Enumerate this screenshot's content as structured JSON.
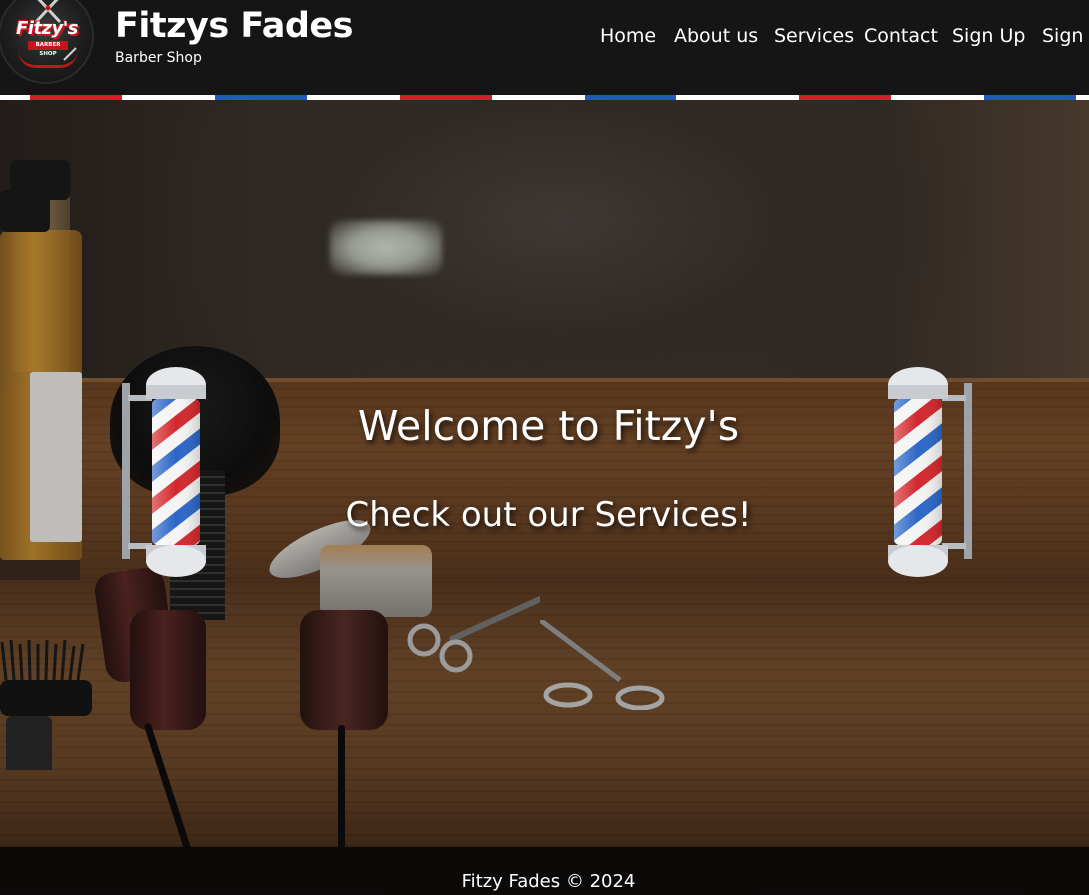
{
  "brand": {
    "logo_text": "Fitzy's",
    "logo_banner": "BARBER SHOP",
    "title": "Fitzys Fades",
    "subtitle": "Barber Shop"
  },
  "nav": {
    "items": [
      {
        "label": "Home"
      },
      {
        "label": "About us"
      },
      {
        "label": "Services"
      },
      {
        "label": "Contact"
      },
      {
        "label": "Sign Up"
      },
      {
        "label": "Sign In"
      }
    ]
  },
  "hero": {
    "title": "Welcome to Fitzy's",
    "subtitle": "Check out our Services!"
  },
  "footer": {
    "copyright": "Fitzy Fades © 2024"
  },
  "colors": {
    "header_bg": "#151515",
    "stripe_red": "#d31f26",
    "stripe_blue": "#1f5bb8",
    "text": "#ffffff"
  },
  "icons": [
    "scissors-icon",
    "barber-pole-icon"
  ]
}
